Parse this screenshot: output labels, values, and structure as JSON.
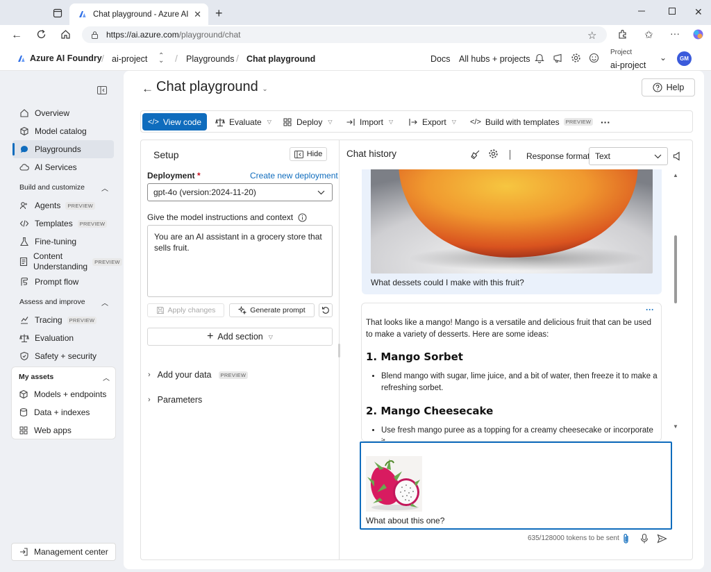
{
  "browser": {
    "tab_title": "Chat playground - Azure AI Foun",
    "url_host": "https://ai.azure.com",
    "url_path": "/playground/chat"
  },
  "header": {
    "brand": "Azure AI Foundry",
    "project_crumb": "ai-project",
    "crumb_playgrounds": "Playgrounds",
    "crumb_current": "Chat playground",
    "docs": "Docs",
    "all_hubs": "All hubs + projects",
    "project_label": "Project",
    "project_name": "ai-project",
    "avatar_initials": "GM"
  },
  "sidebar": {
    "items": [
      {
        "label": "Overview"
      },
      {
        "label": "Model catalog"
      },
      {
        "label": "Playgrounds"
      },
      {
        "label": "AI Services"
      }
    ],
    "group_build": "Build and customize",
    "build_items": [
      {
        "label": "Agents",
        "badge": "PREVIEW"
      },
      {
        "label": "Templates",
        "badge": "PREVIEW"
      },
      {
        "label": "Fine-tuning"
      },
      {
        "label_line1": "Content",
        "label_line2": "Understanding",
        "badge": "PREVIEW"
      },
      {
        "label": "Prompt flow"
      }
    ],
    "group_assess": "Assess and improve",
    "assess_items": [
      {
        "label": "Tracing",
        "badge": "PREVIEW"
      },
      {
        "label": "Evaluation"
      },
      {
        "label": "Safety + security"
      }
    ],
    "group_assets": "My assets",
    "asset_items": [
      {
        "label": "Models + endpoints"
      },
      {
        "label": "Data + indexes"
      },
      {
        "label": "Web apps"
      }
    ],
    "management": "Management center"
  },
  "page": {
    "title": "Chat playground",
    "help": "Help"
  },
  "toolbar": {
    "view_code": "View code",
    "evaluate": "Evaluate",
    "deploy": "Deploy",
    "import": "Import",
    "export": "Export",
    "build_templates": "Build with templates",
    "preview": "PREVIEW",
    "more": "···"
  },
  "setup": {
    "title": "Setup",
    "hide": "Hide",
    "deployment_label": "Deployment",
    "required_mark": "*",
    "create_link": "Create new deployment",
    "deployment_value": "gpt-4o (version:2024-11-20)",
    "instructions_label": "Give the model instructions and context",
    "system_message": "You are an AI assistant in a grocery store that sells fruit.",
    "apply_changes": "Apply changes",
    "generate_prompt": "Generate prompt",
    "add_section": "Add section",
    "add_data": "Add your data",
    "add_data_badge": "PREVIEW",
    "parameters": "Parameters"
  },
  "chat": {
    "title": "Chat history",
    "response_format_label": "Response format",
    "response_format_value": "Text",
    "user_message": "What dessets could I make with this fruit?",
    "assistant_intro": "That looks like a mango! Mango is a versatile and delicious fruit that can be used to make a variety of desserts. Here are some ideas:",
    "heading1": "1. Mango Sorbet",
    "bullet1": "Blend mango with sugar, lime juice, and a bit of water, then freeze it to make a refreshing sorbet.",
    "heading2": "2. Mango Cheesecake",
    "bullet2": "Use fresh mango puree as a topping for a creamy cheesecake or incorporate it",
    "more": "···",
    "composer_text": "What about this one?",
    "tokens": "635/128000 tokens to be sent"
  },
  "colors": {
    "accent": "#0f6cbd",
    "user_bubble": "#eaf1fb",
    "sidebar_active": "#dfe3ea"
  }
}
